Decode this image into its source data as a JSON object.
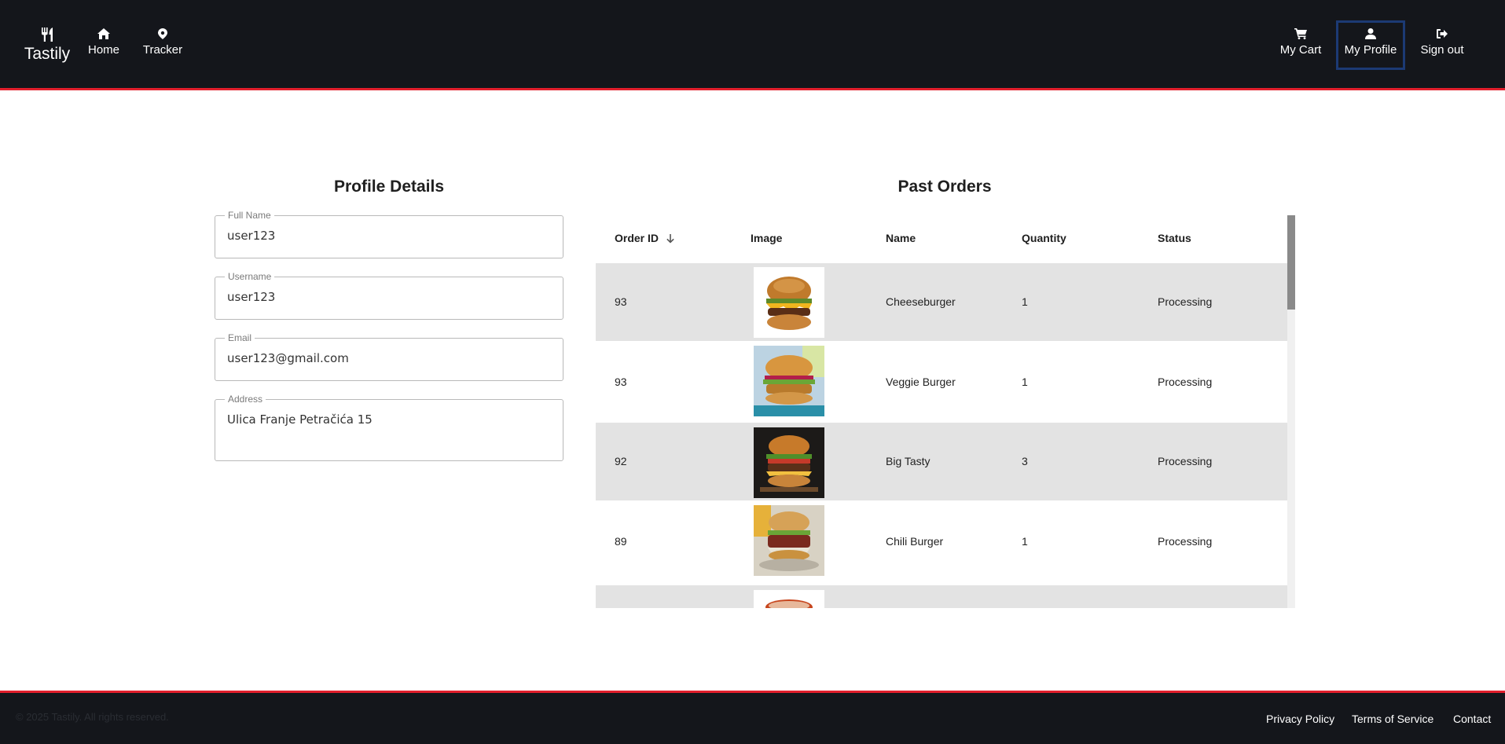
{
  "header": {
    "brand": "Tastily",
    "nav_left": [
      {
        "label": "Home",
        "icon": "home-icon"
      },
      {
        "label": "Tracker",
        "icon": "map-pin-icon"
      }
    ],
    "nav_right": [
      {
        "label": "My Cart",
        "icon": "cart-icon"
      },
      {
        "label": "My Profile",
        "icon": "user-icon",
        "active": true
      },
      {
        "label": "Sign out",
        "icon": "sign-out-icon"
      }
    ]
  },
  "profile": {
    "title": "Profile Details",
    "fields": [
      {
        "label": "Full Name",
        "value": "user123"
      },
      {
        "label": "Username",
        "value": "user123"
      },
      {
        "label": "Email",
        "value": "user123@gmail.com"
      },
      {
        "label": "Address",
        "value": "Ulica Franje Petračića 15"
      }
    ]
  },
  "orders": {
    "title": "Past Orders",
    "columns": [
      "Order ID",
      "Image",
      "Name",
      "Quantity",
      "Status"
    ],
    "sort_icon": "arrow-down-icon",
    "rows": [
      {
        "id": "93",
        "name": "Cheeseburger",
        "quantity": "1",
        "status": "Processing",
        "image": "cheeseburger-image"
      },
      {
        "id": "93",
        "name": "Veggie Burger",
        "quantity": "1",
        "status": "Processing",
        "image": "veggie-burger-image"
      },
      {
        "id": "92",
        "name": "Big Tasty",
        "quantity": "3",
        "status": "Processing",
        "image": "big-tasty-image"
      },
      {
        "id": "89",
        "name": "Chili Burger",
        "quantity": "1",
        "status": "Processing",
        "image": "chili-burger-image"
      }
    ]
  },
  "footer": {
    "copyright": "© 2025 Tastily. All rights reserved.",
    "links": [
      "Privacy Policy",
      "Terms of Service",
      "Contact"
    ]
  },
  "colors": {
    "header_bg": "#14161b",
    "accent_red": "#e21f2c",
    "active_border": "#1c3a74",
    "row_grey": "#e3e3e3"
  }
}
